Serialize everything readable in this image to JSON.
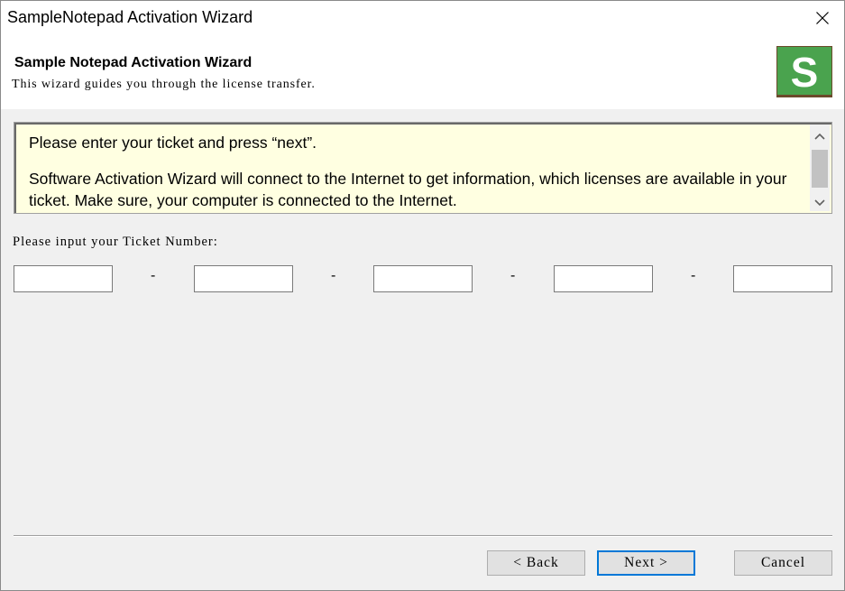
{
  "window": {
    "title": "SampleNotepad Activation Wizard"
  },
  "header": {
    "title": "Sample Notepad Activation Wizard",
    "subtitle": "This wizard guides you through the license transfer.",
    "logo_letter": "S",
    "logo_color": "#4aa34e"
  },
  "info": {
    "line1": "Please enter your ticket and press “next”.",
    "line2": "Software Activation Wizard will connect to the Internet to get information, which licenses are available in your ticket. Make sure, your computer is connected to the Internet."
  },
  "ticket": {
    "label": "Please input your Ticket Number:",
    "fields": [
      "",
      "",
      "",
      "",
      ""
    ],
    "separator": "-"
  },
  "buttons": {
    "back": "< Back",
    "next": "Next >",
    "cancel": "Cancel"
  },
  "colors": {
    "accent": "#0078d7",
    "info_bg": "#ffffe1"
  }
}
